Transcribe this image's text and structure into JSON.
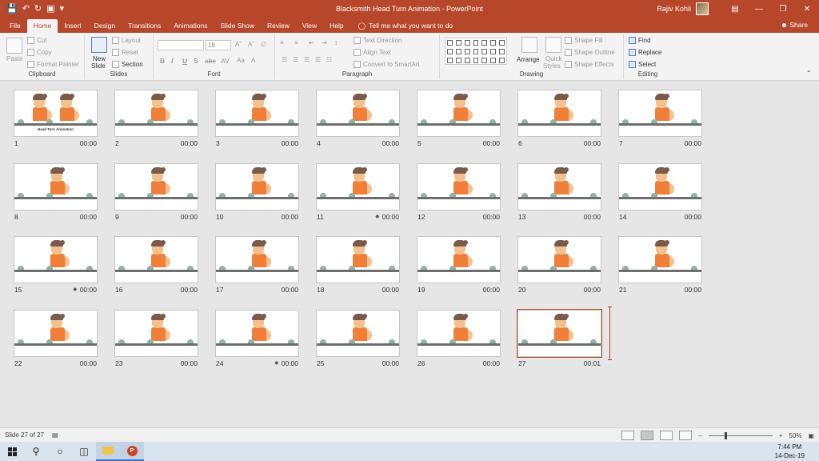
{
  "titlebar": {
    "doc_title": "Blacksmith Head Turn Animation  -  PowerPoint",
    "user_name": "Rajiv Kohli",
    "qat_icons": [
      "save-icon",
      "undo-icon",
      "redo-icon",
      "start-from-beginning-icon",
      "customize-qat-icon"
    ],
    "window_controls": [
      "ribbon-display-options-icon",
      "minimize-icon",
      "restore-icon",
      "close-icon"
    ]
  },
  "tabs": {
    "items": [
      "File",
      "Home",
      "Insert",
      "Design",
      "Transitions",
      "Animations",
      "Slide Show",
      "Review",
      "View",
      "Help"
    ],
    "active": "Home",
    "tell_me": "Tell me what you want to do",
    "share": "Share"
  },
  "ribbon": {
    "clipboard": {
      "label": "Clipboard",
      "paste": "Paste",
      "cut": "Cut",
      "copy": "Copy",
      "format_painter": "Format Painter"
    },
    "slides": {
      "label": "Slides",
      "new_slide_1": "New",
      "new_slide_2": "Slide",
      "layout": "Layout",
      "reset": "Reset",
      "section": "Section"
    },
    "font": {
      "label": "Font",
      "size": "18",
      "buttons": [
        "B",
        "I",
        "U",
        "S",
        "abc",
        "AV"
      ]
    },
    "paragraph": {
      "label": "Paragraph",
      "text_direction": "Text Direction",
      "align_text": "Align Text",
      "convert_smartart": "Convert to SmartArt"
    },
    "drawing": {
      "label": "Drawing",
      "arrange": "Arrange",
      "quick_styles_1": "Quick",
      "quick_styles_2": "Styles",
      "shape_fill": "Shape Fill",
      "shape_outline": "Shape Outline",
      "shape_effects": "Shape Effects"
    },
    "editing": {
      "label": "Editing",
      "find": "Find",
      "replace": "Replace",
      "select": "Select"
    }
  },
  "slides": [
    {
      "num": "1",
      "time": "00:00",
      "caption": "Head Turn Animation",
      "anim": false
    },
    {
      "num": "2",
      "time": "00:00",
      "anim": false
    },
    {
      "num": "3",
      "time": "00:00",
      "anim": false
    },
    {
      "num": "4",
      "time": "00:00",
      "anim": false
    },
    {
      "num": "5",
      "time": "00:00",
      "anim": false
    },
    {
      "num": "6",
      "time": "00:00",
      "anim": false
    },
    {
      "num": "7",
      "time": "00:00",
      "anim": false
    },
    {
      "num": "8",
      "time": "00:00",
      "anim": false
    },
    {
      "num": "9",
      "time": "00:00",
      "anim": false
    },
    {
      "num": "10",
      "time": "00:00",
      "anim": false
    },
    {
      "num": "11",
      "time": "00:00",
      "anim": true
    },
    {
      "num": "12",
      "time": "00:00",
      "anim": false
    },
    {
      "num": "13",
      "time": "00:00",
      "anim": false
    },
    {
      "num": "14",
      "time": "00:00",
      "anim": false
    },
    {
      "num": "15",
      "time": "00:00",
      "anim": true
    },
    {
      "num": "16",
      "time": "00:00",
      "anim": false
    },
    {
      "num": "17",
      "time": "00:00",
      "anim": false
    },
    {
      "num": "18",
      "time": "00:00",
      "anim": false
    },
    {
      "num": "19",
      "time": "00:00",
      "anim": false
    },
    {
      "num": "20",
      "time": "00:00",
      "anim": false
    },
    {
      "num": "21",
      "time": "00:00",
      "anim": false
    },
    {
      "num": "22",
      "time": "00:00",
      "anim": false
    },
    {
      "num": "23",
      "time": "00:00",
      "anim": false
    },
    {
      "num": "24",
      "time": "00:00",
      "anim": true
    },
    {
      "num": "25",
      "time": "00:00",
      "anim": false
    },
    {
      "num": "26",
      "time": "00:00",
      "anim": false
    },
    {
      "num": "27",
      "time": "00:01",
      "anim": false
    }
  ],
  "statusbar": {
    "slide_info": "Slide 27 of 27",
    "zoom": "50%"
  },
  "taskbar": {
    "time": "7:44 PM",
    "date": "14-Dec-19"
  },
  "colors": {
    "accent": "#b7472a",
    "figure_shirt": "#f07f3a",
    "figure_skin": "#f4c08d",
    "figure_hair": "#7a5a4a"
  }
}
